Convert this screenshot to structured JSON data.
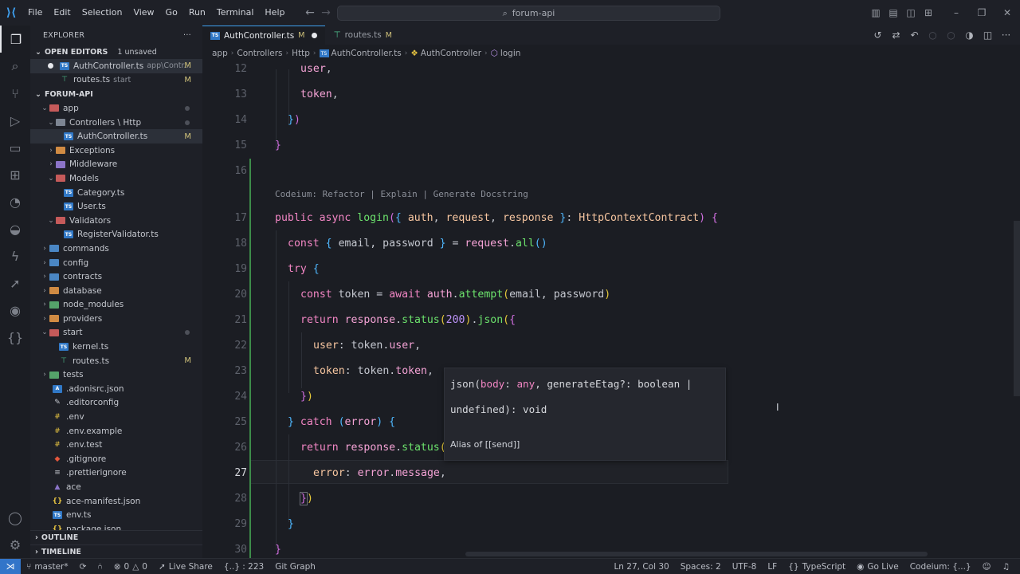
{
  "titlebar": {
    "menu": [
      "File",
      "Edit",
      "Selection",
      "View",
      "Go",
      "Run",
      "Terminal",
      "Help"
    ],
    "search": "forum-api"
  },
  "explorer": {
    "header": "EXPLORER",
    "open_editors": {
      "label": "OPEN EDITORS",
      "badge": "1 unsaved"
    },
    "open_files": [
      {
        "name": "AuthController.ts",
        "path": "app\\Contr...",
        "mark": "M"
      },
      {
        "name": "routes.ts",
        "path": "start",
        "mark": "M"
      }
    ],
    "project": "FORUM-API",
    "tree": [
      {
        "name": "app",
        "mark": ""
      },
      {
        "name": "Controllers \\ Http",
        "mark": ""
      },
      {
        "name": "AuthController.ts",
        "mark": "M"
      },
      {
        "name": "Exceptions",
        "mark": ""
      },
      {
        "name": "Middleware",
        "mark": ""
      },
      {
        "name": "Models",
        "mark": ""
      },
      {
        "name": "Category.ts",
        "mark": ""
      },
      {
        "name": "User.ts",
        "mark": ""
      },
      {
        "name": "Validators",
        "mark": ""
      },
      {
        "name": "RegisterValidator.ts",
        "mark": ""
      },
      {
        "name": "commands",
        "mark": ""
      },
      {
        "name": "config",
        "mark": ""
      },
      {
        "name": "contracts",
        "mark": ""
      },
      {
        "name": "database",
        "mark": ""
      },
      {
        "name": "node_modules",
        "mark": ""
      },
      {
        "name": "providers",
        "mark": ""
      },
      {
        "name": "start",
        "mark": ""
      },
      {
        "name": "kernel.ts",
        "mark": ""
      },
      {
        "name": "routes.ts",
        "mark": "M"
      },
      {
        "name": "tests",
        "mark": ""
      },
      {
        "name": ".adonisrc.json",
        "mark": ""
      },
      {
        "name": ".editorconfig",
        "mark": ""
      },
      {
        "name": ".env",
        "mark": ""
      },
      {
        "name": ".env.example",
        "mark": ""
      },
      {
        "name": ".env.test",
        "mark": ""
      },
      {
        "name": ".gitignore",
        "mark": ""
      },
      {
        "name": ".prettierignore",
        "mark": ""
      },
      {
        "name": "ace",
        "mark": ""
      },
      {
        "name": "ace-manifest.json",
        "mark": ""
      },
      {
        "name": "env.ts",
        "mark": ""
      },
      {
        "name": "package.json",
        "mark": ""
      }
    ],
    "outline": "OUTLINE",
    "timeline": "TIMELINE"
  },
  "tabs": [
    {
      "name": "AuthController.ts",
      "mark": "M"
    },
    {
      "name": "routes.ts",
      "mark": "M"
    }
  ],
  "breadcrumb": [
    "app",
    "Controllers",
    "Http",
    "AuthController.ts",
    "AuthController",
    "login"
  ],
  "editor": {
    "codelens": "Codeium: Refactor | Explain | Generate Docstring",
    "line_numbers": [
      "12",
      "13",
      "14",
      "15",
      "16",
      "17",
      "18",
      "19",
      "20",
      "21",
      "22",
      "23",
      "24",
      "25",
      "26",
      "27",
      "28",
      "29",
      "30"
    ],
    "hover": {
      "sig_line1_a": "json(",
      "sig_line1_b": "body",
      "sig_line1_c": ": ",
      "sig_line1_d": "any",
      "sig_line1_e": ", generateEtag?: boolean |",
      "sig_line2": "undefined): void",
      "doc": "Alias of [[send]]"
    }
  },
  "statusbar": {
    "branch": "master*",
    "errors": "0",
    "warnings": "0",
    "live_share": "Live Share",
    "symbols": "{..} : 223",
    "git_graph": "Git Graph",
    "position": "Ln 27, Col 30",
    "spaces": "Spaces: 2",
    "encoding": "UTF-8",
    "eol": "LF",
    "language": "TypeScript",
    "go_live": "Go Live",
    "codeium": "Codeium: {...}"
  }
}
